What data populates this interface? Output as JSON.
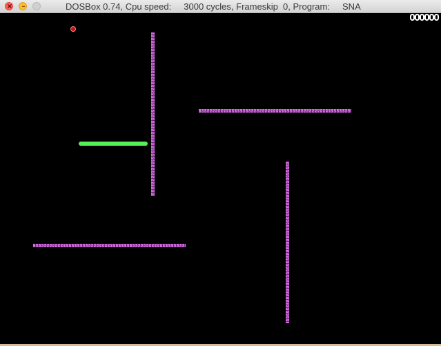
{
  "window": {
    "title": "DOSBox 0.74, Cpu speed:     3000 cycles, Frameskip  0, Program:     SNA"
  },
  "controls": {
    "close_glyph": "×",
    "minimize_glyph": "–"
  },
  "game": {
    "score": "000000",
    "score_digits": [
      "0",
      "0",
      "0",
      "0",
      "0",
      "0"
    ],
    "colors": {
      "wall": "#d36ce0",
      "snake": "#55f055",
      "food": "#c8121a",
      "background": "#000000"
    }
  }
}
